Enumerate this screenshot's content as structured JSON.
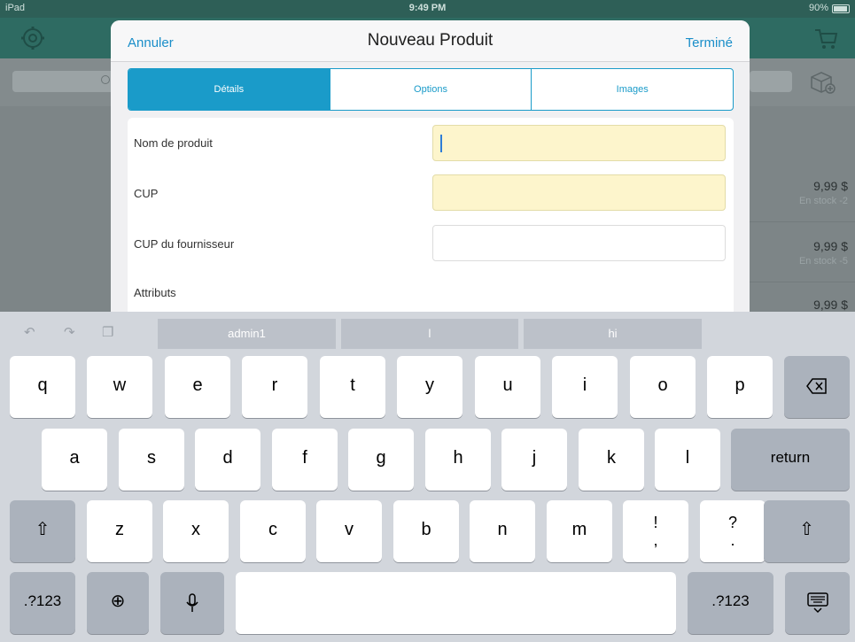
{
  "status": {
    "carrier": "iPad",
    "time": "9:49 PM",
    "battery": "90%"
  },
  "modal": {
    "cancel_label": "Annuler",
    "title": "Nouveau Produit",
    "done_label": "Terminé",
    "tabs": [
      {
        "label": "Détails",
        "active": true
      },
      {
        "label": "Options",
        "active": false
      },
      {
        "label": "Images",
        "active": false
      }
    ],
    "fields": {
      "product_name": {
        "label": "Nom de produit",
        "value": "",
        "required": true
      },
      "upc": {
        "label": "CUP",
        "value": "",
        "required": true
      },
      "supplier_upc": {
        "label": "CUP du fournisseur",
        "value": "",
        "required": false
      },
      "attributes": {
        "label": "Attributs"
      }
    }
  },
  "background_list": [
    {
      "price": "9,99 $",
      "stock": "En stock -2"
    },
    {
      "price": "9,99 $",
      "stock": "En stock -5"
    },
    {
      "price": "9,99 $",
      "stock": ""
    }
  ],
  "keyboard": {
    "suggestions": [
      "admin1",
      "l",
      "hi"
    ],
    "row1": [
      "q",
      "w",
      "e",
      "r",
      "t",
      "y",
      "u",
      "i",
      "o",
      "p"
    ],
    "row2": [
      "a",
      "s",
      "d",
      "f",
      "g",
      "h",
      "j",
      "k",
      "l"
    ],
    "row3": [
      "z",
      "x",
      "c",
      "v",
      "b",
      "n",
      "m"
    ],
    "punct1": {
      "top": "!",
      "bottom": ","
    },
    "punct2": {
      "top": "?",
      "bottom": "."
    },
    "return_label": "return",
    "numbers_label": ".?123"
  },
  "colors": {
    "accent": "#1a9bc9",
    "required_field": "#fdf5cc",
    "appbar": "#2e6b62"
  }
}
